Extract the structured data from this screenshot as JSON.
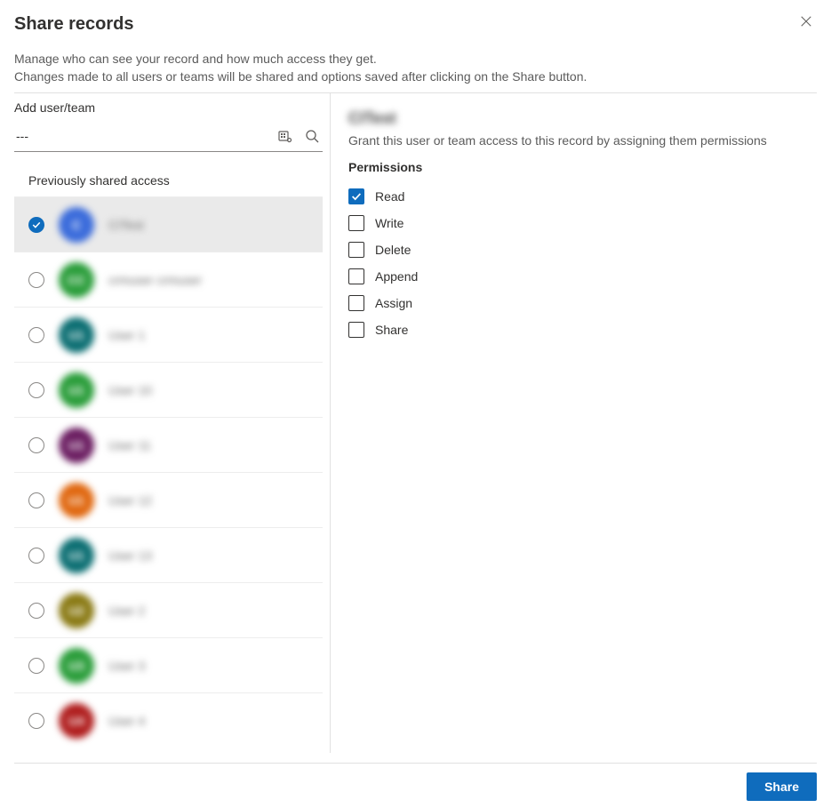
{
  "dialog": {
    "title": "Share records",
    "description_line1": "Manage who can see your record and how much access they get.",
    "description_line2": "Changes made to all users or teams will be shared and options saved after clicking on the Share button."
  },
  "search": {
    "label": "Add user/team",
    "value": "---"
  },
  "list": {
    "section_header": "Previously shared access",
    "items": [
      {
        "name": "CITest",
        "initials": "C",
        "color": "#3a6bdb",
        "selected": true
      },
      {
        "name": "crmuser crmuser",
        "initials": "CC",
        "color": "#2a9d3a",
        "selected": false
      },
      {
        "name": "User 1",
        "initials": "U1",
        "color": "#0b6e72",
        "selected": false
      },
      {
        "name": "User 10",
        "initials": "U1",
        "color": "#2a9d3a",
        "selected": false
      },
      {
        "name": "User 11",
        "initials": "U1",
        "color": "#6b1d61",
        "selected": false
      },
      {
        "name": "User 12",
        "initials": "U1",
        "color": "#e0670f",
        "selected": false
      },
      {
        "name": "User 13",
        "initials": "U1",
        "color": "#0b6e72",
        "selected": false
      },
      {
        "name": "User 2",
        "initials": "U2",
        "color": "#8a7a14",
        "selected": false
      },
      {
        "name": "User 3",
        "initials": "U3",
        "color": "#2a9d3a",
        "selected": false
      },
      {
        "name": "User 4",
        "initials": "U4",
        "color": "#b01e1e",
        "selected": false
      }
    ]
  },
  "detail": {
    "selected_name": "CITest",
    "grant_text": "Grant this user or team access to this record by assigning them permissions",
    "permissions_title": "Permissions",
    "permissions": [
      {
        "label": "Read",
        "checked": true
      },
      {
        "label": "Write",
        "checked": false
      },
      {
        "label": "Delete",
        "checked": false
      },
      {
        "label": "Append",
        "checked": false
      },
      {
        "label": "Assign",
        "checked": false
      },
      {
        "label": "Share",
        "checked": false
      }
    ]
  },
  "footer": {
    "share_label": "Share"
  }
}
